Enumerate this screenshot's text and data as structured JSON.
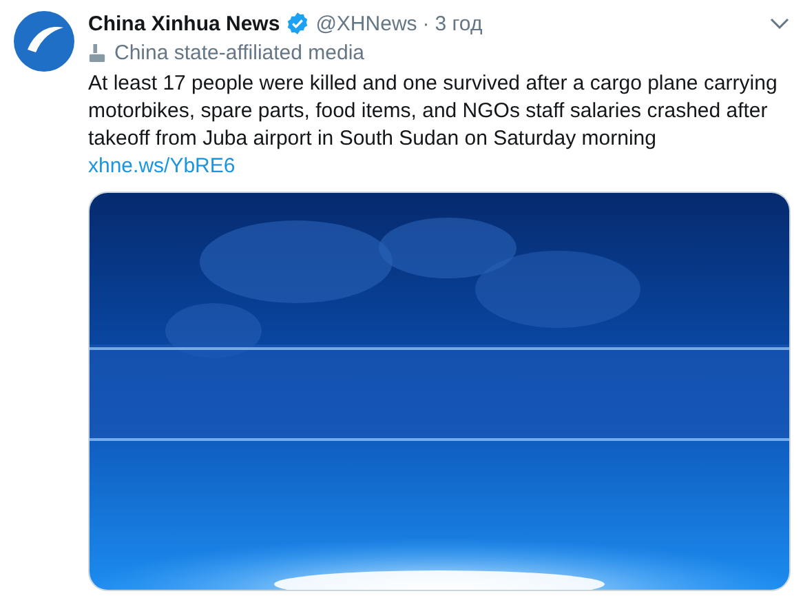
{
  "tweet": {
    "author_name": "China Xinhua News",
    "verified": true,
    "handle": "@XHNews",
    "separator": "·",
    "time": "3 год",
    "label": "China state-affiliated media",
    "text": "At least 17 people were killed and one survived after a cargo plane carrying motorbikes, spare parts, food items, and NGOs staff salaries crashed after takeoff from Juba airport in South Sudan on Saturday morning",
    "link": "xhne.ws/YbRE6"
  }
}
